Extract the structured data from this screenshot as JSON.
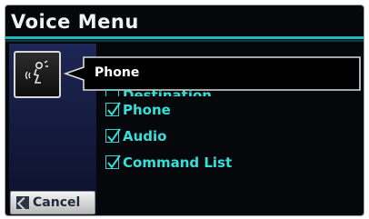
{
  "screen": {
    "title": "Voice Menu"
  },
  "callout": {
    "text": "Phone"
  },
  "menu": {
    "items": [
      {
        "label": "Destination",
        "partial": true
      },
      {
        "label": "Phone"
      },
      {
        "label": "Audio"
      },
      {
        "label": "Command List"
      }
    ]
  },
  "cancel": {
    "label": "Cancel"
  },
  "colors": {
    "accent": "#19b8bd",
    "item_text": "#35e0da"
  },
  "icons": [
    "voice-talk-icon",
    "checkbox-icon",
    "cancel-icon"
  ]
}
